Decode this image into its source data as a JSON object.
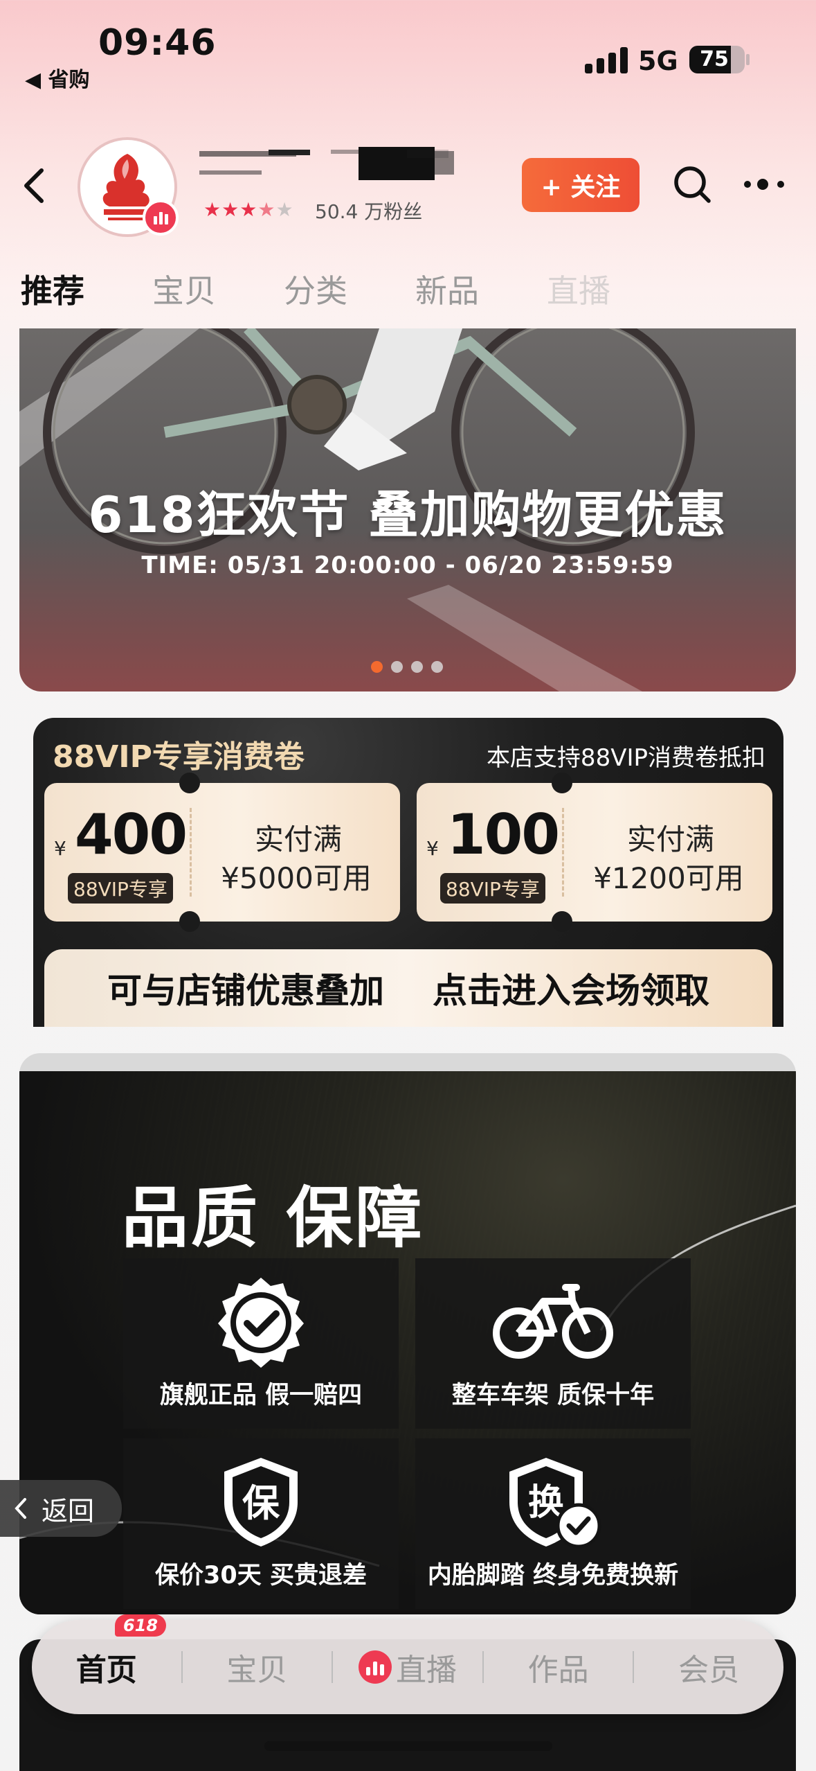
{
  "status_bar": {
    "time": "09:46",
    "back_app": "◀ 省购",
    "network": "5G",
    "battery_level": 75,
    "battery_text": "75"
  },
  "header": {
    "rating": "★★★★★",
    "rating_stars": 3.5,
    "fans": "50.4 万粉丝",
    "follow_label": "+ 关注"
  },
  "tabs": [
    "推荐",
    "宝贝",
    "分类",
    "新品",
    "直播"
  ],
  "banner": {
    "title": "618狂欢节  叠加购物更优惠",
    "time": "TIME:  05/31 20:00:00 - 06/20 23:59:59",
    "slide_count": 4,
    "active_slide": 1
  },
  "vip": {
    "title": "88VIP专享消费卷",
    "subtitle": "本店支持88VIP消费卷抵扣",
    "coupons": [
      {
        "currency": "¥",
        "amount": "400",
        "tag": "88VIP专享",
        "cond1": "实付满",
        "cond2": "¥5000可用"
      },
      {
        "currency": "¥",
        "amount": "100",
        "tag": "88VIP专享",
        "cond1": "实付满",
        "cond2": "¥1200可用"
      }
    ],
    "btn_left": "可与店铺优惠叠加",
    "btn_right": "点击进入会场领取"
  },
  "quality": {
    "title": "品质 保障",
    "items": [
      {
        "label": "旗舰正品  假一赔四",
        "icon": "badge-check-icon"
      },
      {
        "label": "整车车架  质保十年",
        "icon": "bicycle-icon"
      },
      {
        "label": "保价30天  买贵退差",
        "icon": "shield-bao-icon",
        "icon_text": "保"
      },
      {
        "label": "内胎脚踏  终身免费换新",
        "icon": "shield-huan-icon",
        "icon_text": "换"
      }
    ]
  },
  "return_label": "返回",
  "bottom_nav": {
    "badge": "618",
    "items": [
      "首页",
      "宝贝",
      "直播",
      "作品",
      "会员"
    ]
  }
}
